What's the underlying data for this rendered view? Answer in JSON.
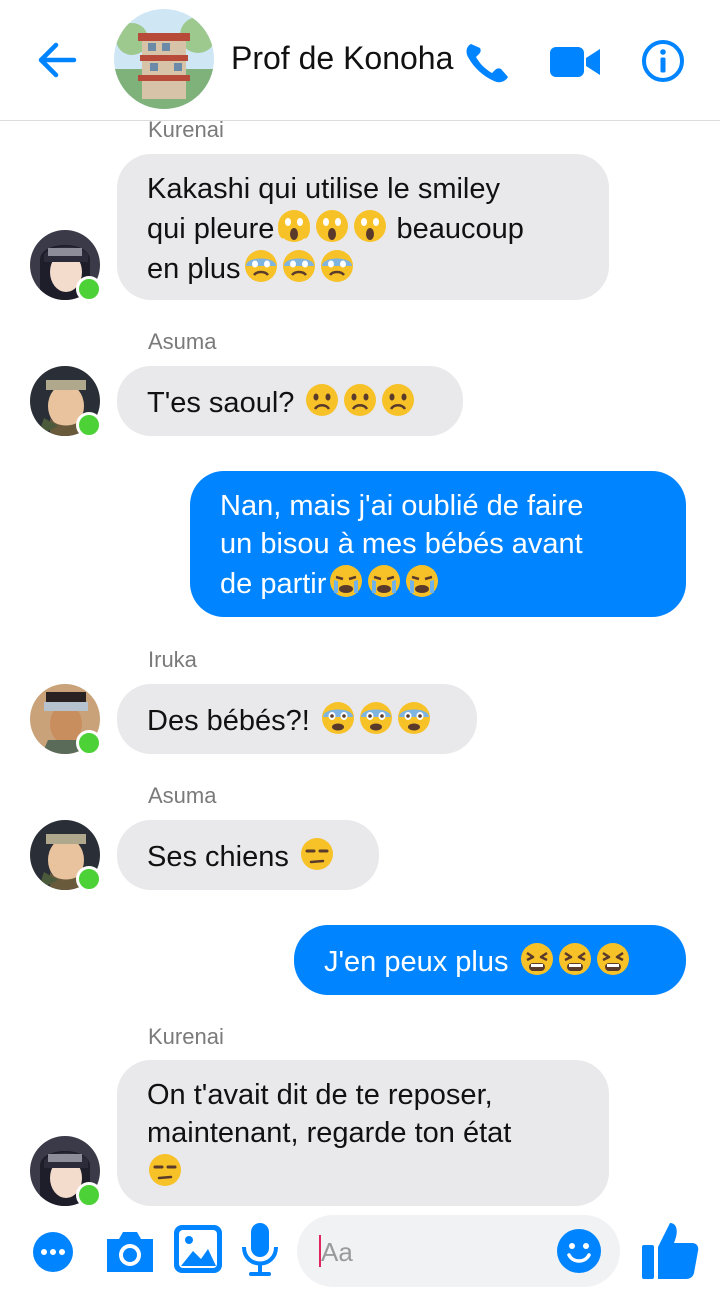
{
  "header": {
    "title": "Prof de Konoha",
    "accent": "#0084ff"
  },
  "messages": [
    {
      "id": "m1",
      "sender": "Kurenai",
      "direction": "in",
      "text": "Kakashi qui utilise le smiley\nqui pleure",
      "emoji": [
        "screaming-face",
        "screaming-face",
        "screaming-face"
      ],
      "after": "beaucoup\nen plus",
      "emoji2": [
        "anxious-face",
        "anxious-face",
        "anxious-face"
      ]
    },
    {
      "id": "m2",
      "sender": "Asuma",
      "direction": "in",
      "text": "T'es saoul?",
      "emoji": [
        "worried-face",
        "worried-face",
        "worried-face"
      ]
    },
    {
      "id": "m3",
      "direction": "out",
      "text": "Nan, mais j'ai oublié de faire\nun bisou à mes bébés avant\nde partir",
      "emoji": [
        "crying-face",
        "crying-face",
        "crying-face"
      ]
    },
    {
      "id": "m4",
      "sender": "Iruka",
      "direction": "in",
      "text": "Des bébés?!",
      "emoji": [
        "fearful-face",
        "fearful-face",
        "fearful-face"
      ]
    },
    {
      "id": "m5",
      "sender": "Asuma",
      "direction": "in",
      "text": "Ses chiens",
      "emoji": [
        "unamused-face"
      ]
    },
    {
      "id": "m6",
      "direction": "out",
      "text": "J'en peux plus",
      "emoji": [
        "tired-face",
        "tired-face",
        "tired-face"
      ]
    },
    {
      "id": "m7",
      "sender": "Kurenai",
      "direction": "in",
      "text": "On t'avait dit de te reposer,\nmaintenant, regarde ton état",
      "emoji": [
        "unamused-face"
      ]
    }
  ],
  "composer": {
    "placeholder": "Aa",
    "icons": [
      "more-icon",
      "camera-icon",
      "gallery-icon",
      "microphone-icon",
      "emoji-icon",
      "like-thumb-icon"
    ]
  },
  "colors": {
    "incoming_bubble": "#e9e9eb",
    "outgoing_bubble": "#0084ff",
    "online_dot": "#4cd137"
  }
}
